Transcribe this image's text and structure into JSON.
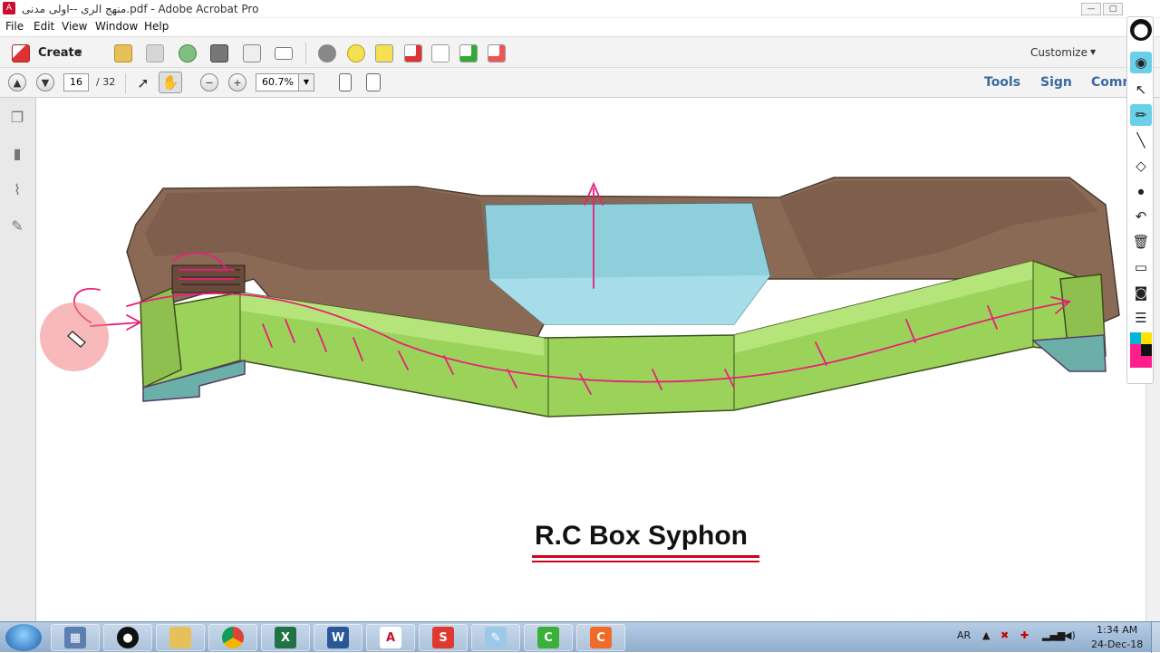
{
  "window": {
    "title": "منهج الرى --اولى مدنى.pdf - Adobe Acrobat Pro",
    "minimize": "—",
    "maximize": "□",
    "close": "✕"
  },
  "menu": [
    "File",
    "Edit",
    "View",
    "Window",
    "Help"
  ],
  "toolbar": {
    "create_label": "Create",
    "customize_label": "Customize"
  },
  "navigation": {
    "current_page": "16",
    "total_pages": "/ 32",
    "zoom": "60.7%"
  },
  "panel_tabs": {
    "tools": "Tools",
    "sign": "Sign",
    "comment": "Comm"
  },
  "document": {
    "heading": "R.C Box Syphon"
  },
  "taskbar": {
    "language": "AR",
    "time": "1:34 AM",
    "date": "24-Dec-18"
  },
  "colors": {
    "accent": "#3a6aa0",
    "annotation_pink": "#e8207a",
    "syphon_green": "#9bd35a",
    "earth_brown": "#8b6a55",
    "water_blue": "#8fd0e0"
  }
}
